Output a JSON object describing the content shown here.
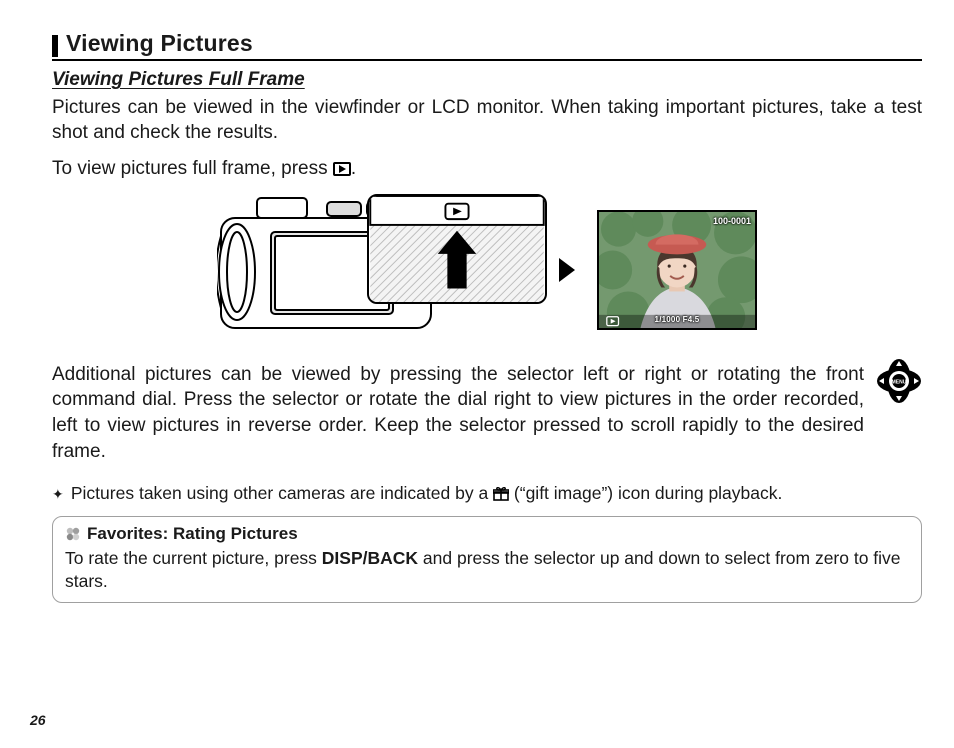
{
  "page_number": "26",
  "heading": "Viewing Pictures",
  "subheading": "Viewing Pictures Full Frame",
  "intro": "Pictures can be viewed in the viewfinder or LCD monitor.  When taking important pictures, take a test shot and check the results.",
  "instruction_pre": "To view pictures full frame, press ",
  "instruction_post": ".",
  "lcd_overlay": {
    "frame_id": "100-0001",
    "exposure_line": "1/1000   F4.5"
  },
  "additional": "Additional pictures can be viewed by pressing the selector left or right or rotating the front command dial.  Press the selector or rotate the dial right to view pictures in the order recorded, left to view pictures in reverse order.  Keep the selector pressed to scroll rapidly to the desired frame.",
  "note_pre": "Pictures taken using other cameras are indicated by a ",
  "note_post": " (“gift image”) icon during playback.",
  "tip": {
    "title": "Favorites: Rating Pictures",
    "body_pre": "To rate the current picture, press ",
    "body_bold": "DISP/BACK",
    "body_post": " and press the selector up and down to select from zero to five stars."
  }
}
